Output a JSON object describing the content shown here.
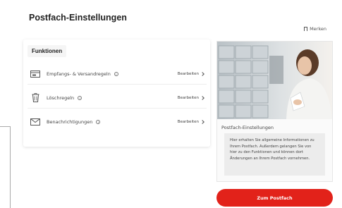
{
  "page": {
    "title": "Postfach-Einstellungen",
    "bookmark_label": "Merken"
  },
  "functions": {
    "heading": "Funktionen",
    "items": [
      {
        "label": "Empfangs- & Versandregeln",
        "action": "Bearbeiten",
        "icon": "inbox-tray-icon"
      },
      {
        "label": "Löschregeln",
        "action": "Bearbeiten",
        "icon": "trash-icon"
      },
      {
        "label": "Benachrichtigungen",
        "action": "Bearbeiten",
        "icon": "envelope-icon"
      }
    ]
  },
  "info_panel": {
    "title": "Postfach-Einstellungen",
    "text": "Hier erhalten Sie allgemeine Informationen zu Ihrem Postfach. Außerdem gelangen Sie von hier zu den Funktionen und können dort Änderungen an Ihrem Postfach vornehmen.",
    "cta_label": "Zum Postfach"
  },
  "colors": {
    "accent": "#e2221a"
  }
}
